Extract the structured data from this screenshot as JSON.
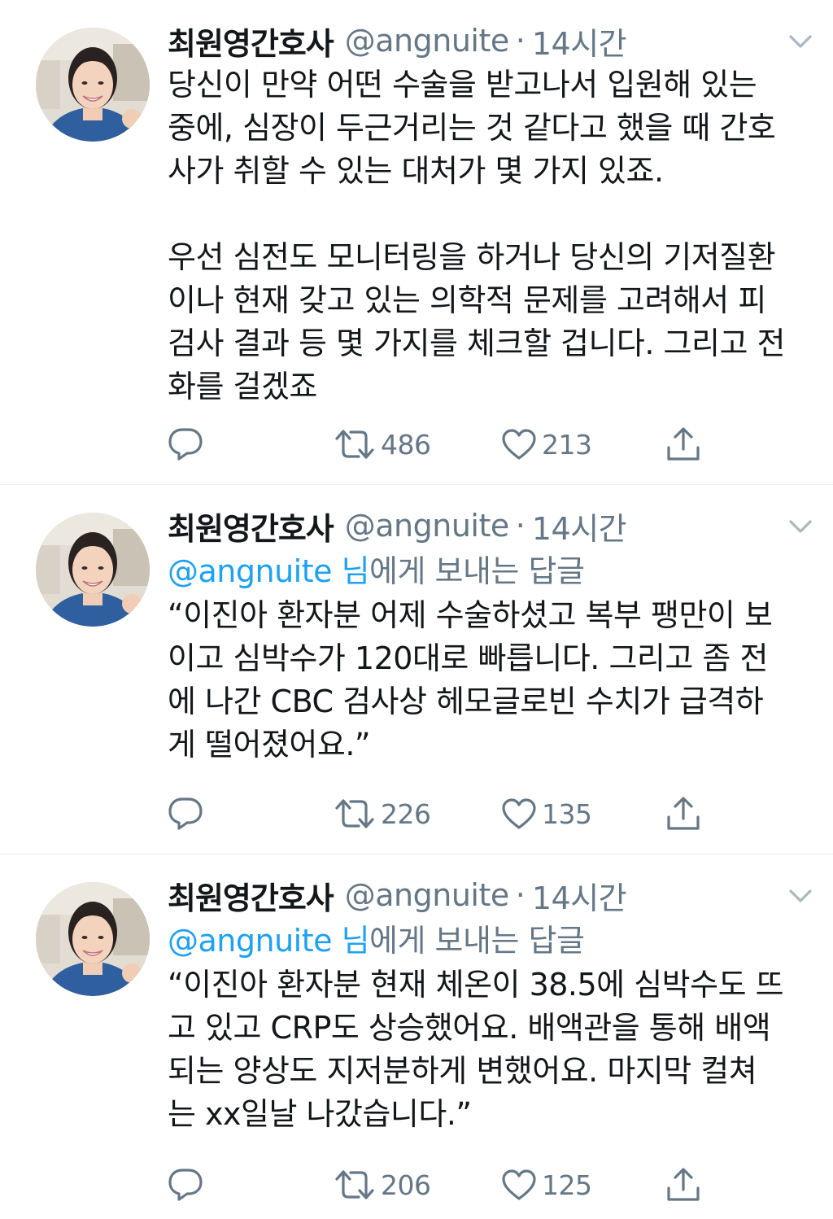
{
  "colors": {
    "text": "#14171a",
    "secondary": "#657786",
    "mention": "#1da1f2",
    "divider": "#e6ecf0"
  },
  "icons": {
    "reply": "speech-bubble-icon",
    "retweet": "retweet-arrows-icon",
    "like": "heart-icon",
    "share": "share-upload-icon",
    "more": "chevron-down-icon"
  },
  "tweets": [
    {
      "name": "최원영간호사",
      "handle": "@angnuite",
      "dot": "·",
      "time": "14시간",
      "lines": [
        "당신이 만약 어떤 수술을 받고나서 입원해 있는",
        "중에, 심장이 두근거리는 것 같다고 했을 때 간호",
        "사가 취할 수 있는 대처가 몇 가지 있죠."
      ],
      "lines2": [
        "우선 심전도 모니터링을 하거나 당신의 기저질환",
        "이나 현재 갖고 있는 의학적 문제를 고려해서 피",
        "검사 결과 등 몇 가지를 체크할 겁니다. 그리고 전",
        "화를 걸겠죠"
      ],
      "retweets": "486",
      "likes": "213"
    },
    {
      "name": "최원영간호사",
      "handle": "@angnuite",
      "dot": "·",
      "time": "14시간",
      "reply_mention": "@angnuite 님",
      "reply_suffix": "에게 보내는 답글",
      "lines": [
        "“이진아 환자분 어제 수술하셨고 복부 팽만이 보",
        "이고 심박수가 120대로 빠릅니다. 그리고 좀 전",
        "에 나간 CBC 검사상 헤모글로빈 수치가 급격하",
        "게 떨어졌어요.”"
      ],
      "retweets": "226",
      "likes": "135"
    },
    {
      "name": "최원영간호사",
      "handle": "@angnuite",
      "dot": "·",
      "time": "14시간",
      "reply_mention": "@angnuite 님",
      "reply_suffix": "에게 보내는 답글",
      "lines": [
        "“이진아 환자분 현재 체온이 38.5에 심박수도 뜨",
        "고 있고 CRP도 상승했어요. 배액관을 통해 배액",
        "되는 양상도 지저분하게 변했어요. 마지막 컬쳐",
        "는 xx일날 나갔습니다.”"
      ],
      "retweets": "206",
      "likes": "125"
    }
  ]
}
